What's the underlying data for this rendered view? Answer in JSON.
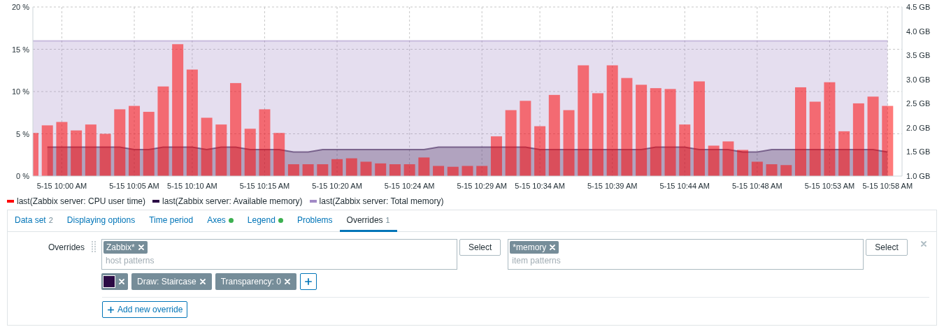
{
  "chart": {
    "chart_data": {
      "type": "bar",
      "grid": true,
      "ylim": [
        0,
        20
      ],
      "y2lim": [
        1.0,
        4.5
      ],
      "categories": [
        null,
        null,
        "5-15 10:00 AM",
        null,
        null,
        null,
        null,
        "5-15 10:05 AM",
        null,
        null,
        null,
        "5-15 10:10 AM",
        null,
        null,
        null,
        null,
        "5-15 10:15 AM",
        null,
        null,
        null,
        null,
        "5-15 10:20 AM",
        null,
        null,
        null,
        null,
        "5-15 10:24 AM",
        null,
        null,
        null,
        null,
        "5-15 10:29 AM",
        null,
        null,
        null,
        "5-15 10:34 AM",
        null,
        null,
        null,
        null,
        "5-15 10:39 AM",
        null,
        null,
        null,
        null,
        "5-15 10:44 AM",
        null,
        null,
        null,
        null,
        "5-15 10:48 AM",
        null,
        null,
        null,
        null,
        "5-15 10:53 AM",
        null,
        null,
        null,
        "5-15 10:58 AM"
      ],
      "yticks": [
        {
          "value": 0,
          "label": "0 %"
        },
        {
          "value": 5,
          "label": "5 %"
        },
        {
          "value": 10,
          "label": "10 %"
        },
        {
          "value": 15,
          "label": "15 %"
        },
        {
          "value": 20,
          "label": "20 %"
        }
      ],
      "y2ticks": [
        {
          "value": 1.0,
          "label": "1.0 GB"
        },
        {
          "value": 1.5,
          "label": "1.5 GB"
        },
        {
          "value": 2.0,
          "label": "2.0 GB"
        },
        {
          "value": 2.5,
          "label": "2.5 GB"
        },
        {
          "value": 3.0,
          "label": "3.0 GB"
        },
        {
          "value": 3.5,
          "label": "3.5 GB"
        },
        {
          "value": 4.0,
          "label": "4.0 GB"
        },
        {
          "value": 4.5,
          "label": "4.5 GB"
        }
      ],
      "series": [
        {
          "name": "last(Zabbix server: CPU user time)",
          "color": "#ff0000",
          "values": [
            5.1,
            6.0,
            6.4,
            5.4,
            6.1,
            5.0,
            7.9,
            8.3,
            7.6,
            10.6,
            15.6,
            12.6,
            6.9,
            6.1,
            11.0,
            5.6,
            7.9,
            5.1,
            1.4,
            1.4,
            1.4,
            2.0,
            2.1,
            1.7,
            1.5,
            1.4,
            1.4,
            2.2,
            1.2,
            1.1,
            1.2,
            1.2,
            4.7,
            7.8,
            8.9,
            5.9,
            9.6,
            7.8,
            13.1,
            9.8,
            13.1,
            11.6,
            10.8,
            10.4,
            10.3,
            6.1,
            11.2,
            3.6,
            4.1,
            3.1,
            1.7,
            1.4,
            1.3,
            10.5,
            8.8,
            11.1,
            5.3,
            8.6,
            9.4,
            8.3
          ]
        },
        {
          "name": "last(Zabbix server: Available memory)",
          "color": "#2b0a45",
          "type": "area",
          "axis": "y2",
          "values": [
            null,
            1.6,
            1.6,
            1.6,
            1.6,
            1.6,
            1.6,
            1.55,
            1.55,
            1.6,
            1.6,
            1.6,
            1.55,
            1.6,
            1.6,
            1.55,
            1.55,
            1.55,
            1.5,
            1.5,
            1.55,
            1.55,
            1.55,
            1.55,
            1.55,
            1.55,
            1.55,
            1.55,
            1.6,
            1.6,
            1.6,
            1.6,
            1.6,
            1.6,
            1.6,
            1.55,
            1.55,
            1.55,
            1.55,
            1.55,
            1.55,
            1.55,
            1.55,
            1.6,
            1.6,
            1.6,
            1.55,
            1.55,
            1.55,
            1.5,
            1.5,
            1.55,
            1.55,
            1.55,
            1.55,
            1.55,
            1.55,
            1.55,
            1.55,
            1.5
          ]
        },
        {
          "name": "last(Zabbix server: Total memory)",
          "color": "#a28ac6",
          "type": "area",
          "axis": "y2",
          "values": [
            3.8,
            3.8,
            3.8,
            3.8,
            3.8,
            3.8,
            3.8,
            3.8,
            3.8,
            3.8,
            3.8,
            3.8,
            3.8,
            3.8,
            3.8,
            3.8,
            3.8,
            3.8,
            3.8,
            3.8,
            3.8,
            3.8,
            3.8,
            3.8,
            3.8,
            3.8,
            3.8,
            3.8,
            3.8,
            3.8,
            3.8,
            3.8,
            3.8,
            3.8,
            3.8,
            3.8,
            3.8,
            3.8,
            3.8,
            3.8,
            3.8,
            3.8,
            3.8,
            3.8,
            3.8,
            3.8,
            3.8,
            3.8,
            3.8,
            3.8,
            3.8,
            3.8,
            3.8,
            3.8,
            3.8,
            3.8,
            3.8,
            3.8,
            3.8,
            3.8
          ]
        }
      ]
    }
  },
  "tabs": [
    {
      "label": "Data set",
      "count": "2",
      "indicator": false,
      "selected": false
    },
    {
      "label": "Displaying options",
      "indicator": false,
      "selected": false
    },
    {
      "label": "Time period",
      "indicator": false,
      "selected": false
    },
    {
      "label": "Axes",
      "indicator": true,
      "selected": false
    },
    {
      "label": "Legend",
      "indicator": true,
      "selected": false
    },
    {
      "label": "Problems",
      "indicator": false,
      "selected": false
    },
    {
      "label": "Overrides",
      "count": "1",
      "indicator": false,
      "selected": true
    }
  ],
  "overrides": {
    "label": "Overrides",
    "items": [
      {
        "host_tags": [
          "Zabbix*"
        ],
        "host_placeholder": "host patterns",
        "host_button": "Select",
        "item_tags": [
          "*memory"
        ],
        "item_placeholder": "item patterns",
        "item_button": "Select",
        "options": [
          {
            "kind": "color",
            "color": "#2b0a45"
          },
          {
            "kind": "tag",
            "label": "Draw: Staircase"
          },
          {
            "kind": "tag",
            "label": "Transparency: 0"
          }
        ]
      }
    ],
    "add_button": "Add new override"
  }
}
